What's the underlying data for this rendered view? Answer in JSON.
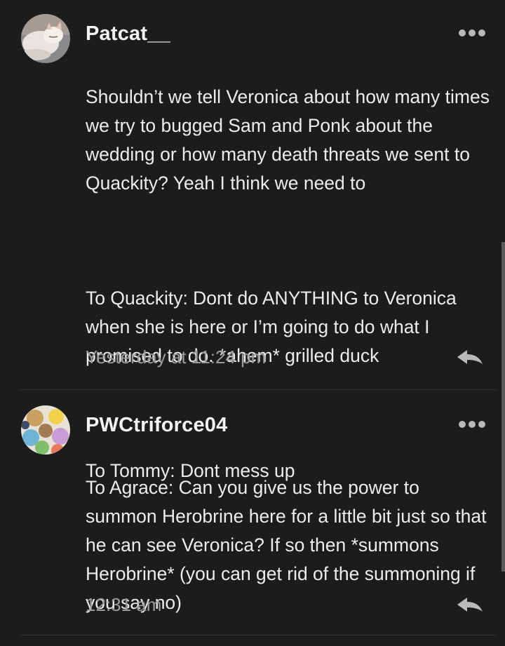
{
  "comments": [
    {
      "username": "Patcat__",
      "avatar_icon": "cat-photo-avatar",
      "paragraphs": [
        "Shouldn’t we tell Veronica about how many times we try to bugged Sam and Ponk about the wedding or how many death threats we sent to Quackity? Yeah I think we need to",
        "To Quackity: Dont do ANYTHING to Veronica when she is here or I’m going to do what I promised to do. *ahem* grilled duck",
        "To Tommy: Dont mess up"
      ],
      "timestamp": "Yesterday at 11:24 pm"
    },
    {
      "username": "PWCtriforce04",
      "avatar_icon": "eevee-collage-avatar",
      "paragraphs": [
        "To Agrace: Can you give us the power to summon Herobrine here for a little bit just so that he can see Veronica? If so then *summons Herobrine* (you can get rid of the summoning if you say no)"
      ],
      "timestamp": "12:31 am"
    }
  ],
  "icons": {
    "more": "more-options-icon",
    "reply": "reply-arrow-icon"
  },
  "colors": {
    "background": "#1c1c1c",
    "text": "#ececec",
    "timestamp": "#9a9a9a",
    "icon": "#b9b9b9"
  }
}
